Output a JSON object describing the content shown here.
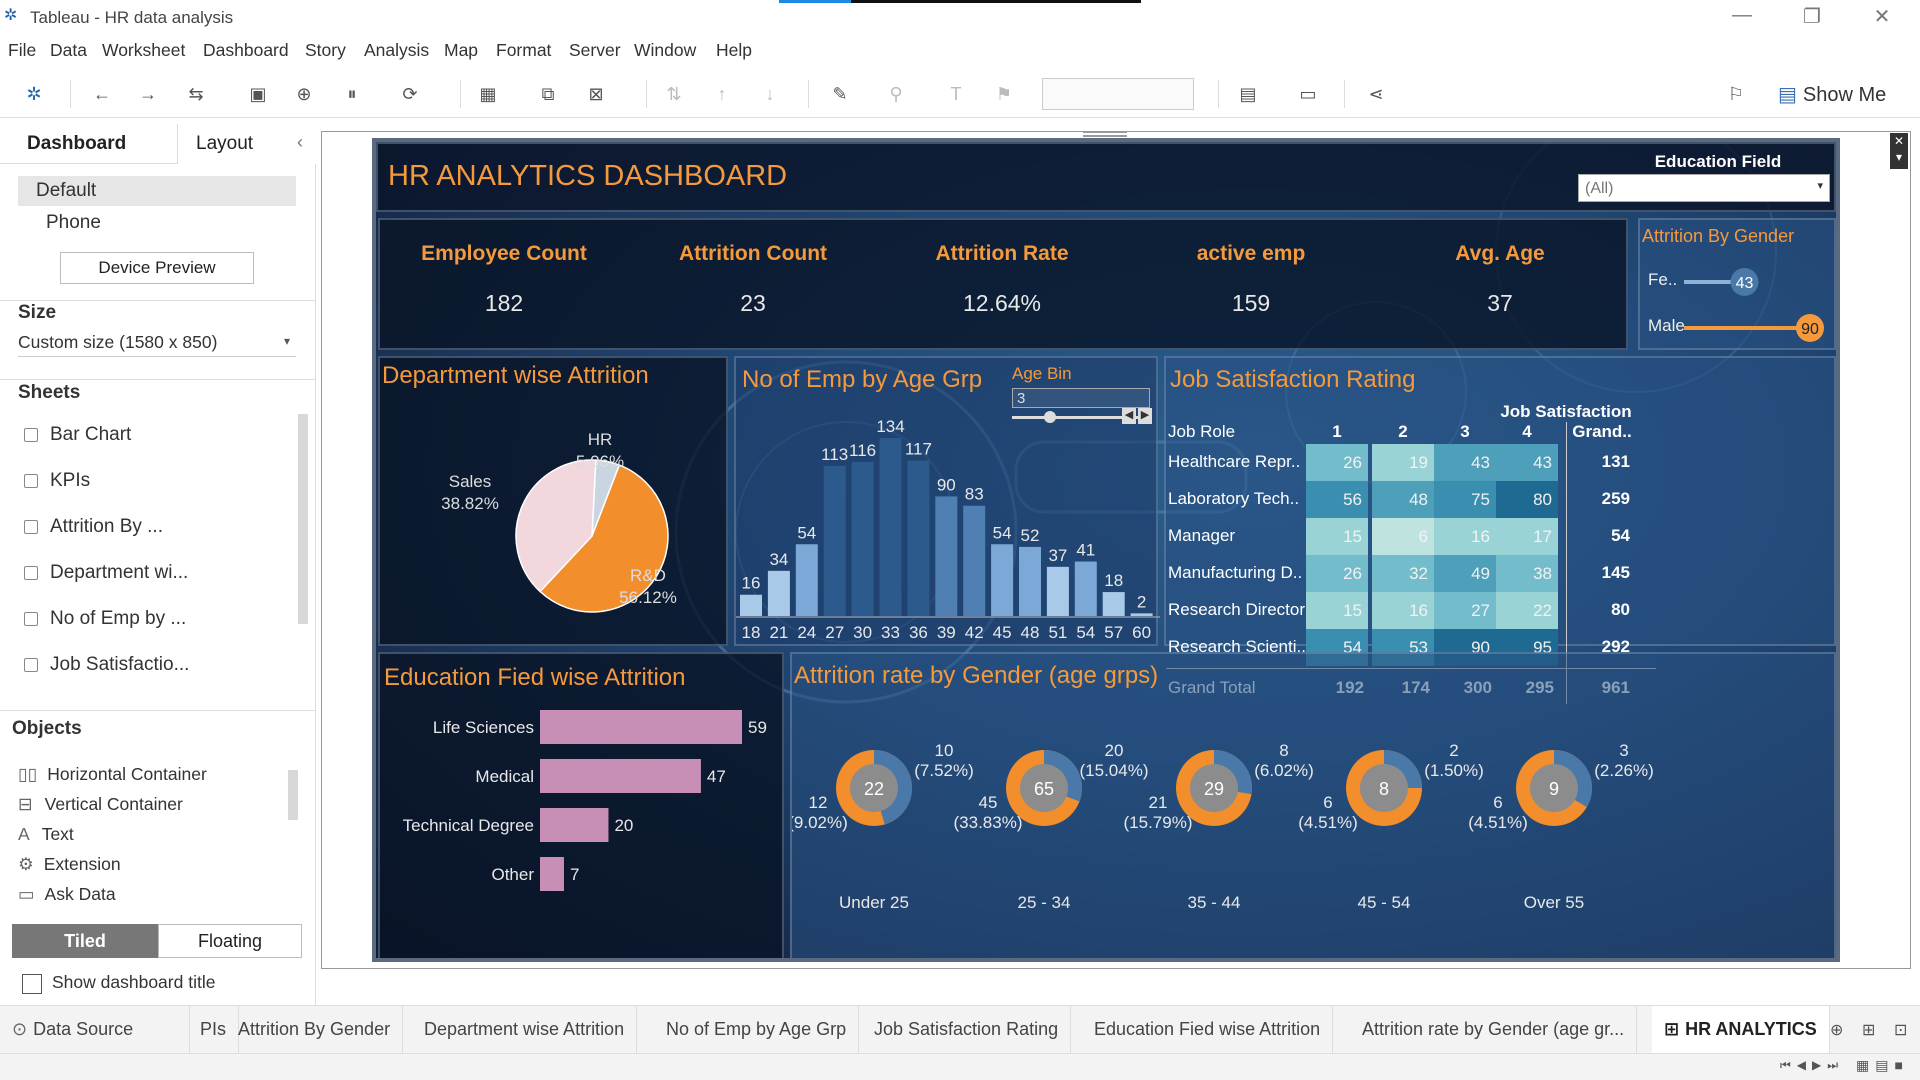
{
  "window": {
    "title": "Tableau - HR data analysis"
  },
  "menu": [
    "File",
    "Data",
    "Worksheet",
    "Dashboard",
    "Story",
    "Analysis",
    "Map",
    "Format",
    "Server",
    "Window",
    "Help"
  ],
  "toolbar": {
    "show_me": "Show Me"
  },
  "left_panel": {
    "tab_dashboard": "Dashboard",
    "tab_layout": "Layout",
    "device_default": "Default",
    "device_phone": "Phone",
    "device_preview": "Device Preview",
    "size_title": "Size",
    "size_value": "Custom size (1580 x 850)",
    "sheets_title": "Sheets",
    "sheets": [
      "Bar Chart",
      "KPIs",
      "Attrition By ...",
      "Department wi...",
      "No of Emp by ...",
      "Job Satisfactio..."
    ],
    "objects_title": "Objects",
    "objects": [
      "Horizontal Container",
      "Vertical Container",
      "Text",
      "Extension",
      "Ask Data"
    ],
    "tiled": "Tiled",
    "floating": "Floating",
    "show_title": "Show dashboard title"
  },
  "dashboard": {
    "title": "HR ANALYTICS DASHBOARD",
    "filter_label": "Education Field",
    "filter_value": "(All)",
    "kpis": [
      {
        "label": "Employee Count",
        "value": "182"
      },
      {
        "label": "Attrition Count",
        "value": "23"
      },
      {
        "label": "Attrition Rate",
        "value": "12.64%"
      },
      {
        "label": "active emp",
        "value": "159"
      },
      {
        "label": "Avg. Age",
        "value": "37"
      }
    ],
    "gender": {
      "title": "Attrition By Gender",
      "female_label": "Fe..",
      "female_value": "43",
      "male_label": "Male",
      "male_value": "90",
      "female_frac": 0.48,
      "male_frac": 1.0
    },
    "dept": {
      "title": "Department wise Attrition",
      "hr_label": "HR",
      "hr_pct": "5.06%",
      "sales_label": "Sales",
      "sales_pct": "38.82%",
      "rd_label": "R&D",
      "rd_pct": "56.12%"
    },
    "age": {
      "title": "No of Emp by Age Grp",
      "bin_label": "Age Bin",
      "bin_value": "3"
    },
    "job": {
      "title": "Job Satisfaction Rating",
      "header": "Job Satisfaction",
      "col_role": "Job Role",
      "cols": [
        "1",
        "2",
        "3",
        "4",
        "Grand.."
      ],
      "rows": [
        {
          "role": "Healthcare Repr..",
          "v": [
            "26",
            "19",
            "43",
            "43"
          ],
          "total": "131"
        },
        {
          "role": "Laboratory Tech..",
          "v": [
            "56",
            "48",
            "75",
            "80"
          ],
          "total": "259"
        },
        {
          "role": "Manager",
          "v": [
            "15",
            "6",
            "16",
            "17"
          ],
          "total": "54"
        },
        {
          "role": "Manufacturing D..",
          "v": [
            "26",
            "32",
            "49",
            "38"
          ],
          "total": "145"
        },
        {
          "role": "Research Director",
          "v": [
            "15",
            "16",
            "27",
            "22"
          ],
          "total": "80"
        },
        {
          "role": "Research Scienti..",
          "v": [
            "54",
            "53",
            "90",
            "95"
          ],
          "total": "292"
        }
      ],
      "grand": {
        "role": "Grand Total",
        "v": [
          "192",
          "174",
          "300",
          "295"
        ],
        "total": "961"
      }
    },
    "edu": {
      "title": "Education Fied wise Attrition"
    },
    "gender_age": {
      "title": "Attrition rate by Gender (age grps)",
      "groups": [
        {
          "name": "Under 25",
          "center": "22",
          "top": "10",
          "top_pct": "(7.52%)",
          "bottom": "12",
          "bottom_pct": "(9.02%)"
        },
        {
          "name": "25 - 34",
          "center": "65",
          "top": "20",
          "top_pct": "(15.04%)",
          "bottom": "45",
          "bottom_pct": "(33.83%)"
        },
        {
          "name": "35 - 44",
          "center": "29",
          "top": "8",
          "top_pct": "(6.02%)",
          "bottom": "21",
          "bottom_pct": "(15.79%)"
        },
        {
          "name": "45 - 54",
          "center": "8",
          "top": "2",
          "top_pct": "(1.50%)",
          "bottom": "6",
          "bottom_pct": "(4.51%)"
        },
        {
          "name": "Over 55",
          "center": "9",
          "top": "3",
          "top_pct": "(2.26%)",
          "bottom": "6",
          "bottom_pct": "(4.51%)"
        }
      ]
    }
  },
  "sheet_tabs": [
    "Data Source",
    "PIs",
    "Attrition By Gender",
    "Department wise Attrition",
    "No of Emp by Age Grp",
    "Job Satisfaction Rating",
    "Education Fied wise Attrition",
    "Attrition rate by Gender (age gr...",
    "HR ANALYTICS"
  ],
  "chart_data": [
    {
      "type": "pie",
      "categories": [
        "R&D",
        "Sales",
        "HR"
      ],
      "values": [
        56.12,
        38.82,
        5.06
      ],
      "title": "Department wise Attrition"
    },
    {
      "type": "bar",
      "title": "No of Emp by Age Grp",
      "categories": [
        "18",
        "21",
        "24",
        "27",
        "30",
        "33",
        "36",
        "39",
        "42",
        "45",
        "48",
        "51",
        "54",
        "57",
        "60"
      ],
      "values": [
        16,
        34,
        54,
        113,
        116,
        134,
        117,
        90,
        83,
        54,
        52,
        37,
        41,
        18,
        2
      ]
    },
    {
      "type": "bar",
      "title": "Education Fied wise Attrition",
      "categories": [
        "Life Sciences",
        "Medical",
        "Technical Degree",
        "Other"
      ],
      "values": [
        59,
        47,
        20,
        7
      ]
    }
  ]
}
